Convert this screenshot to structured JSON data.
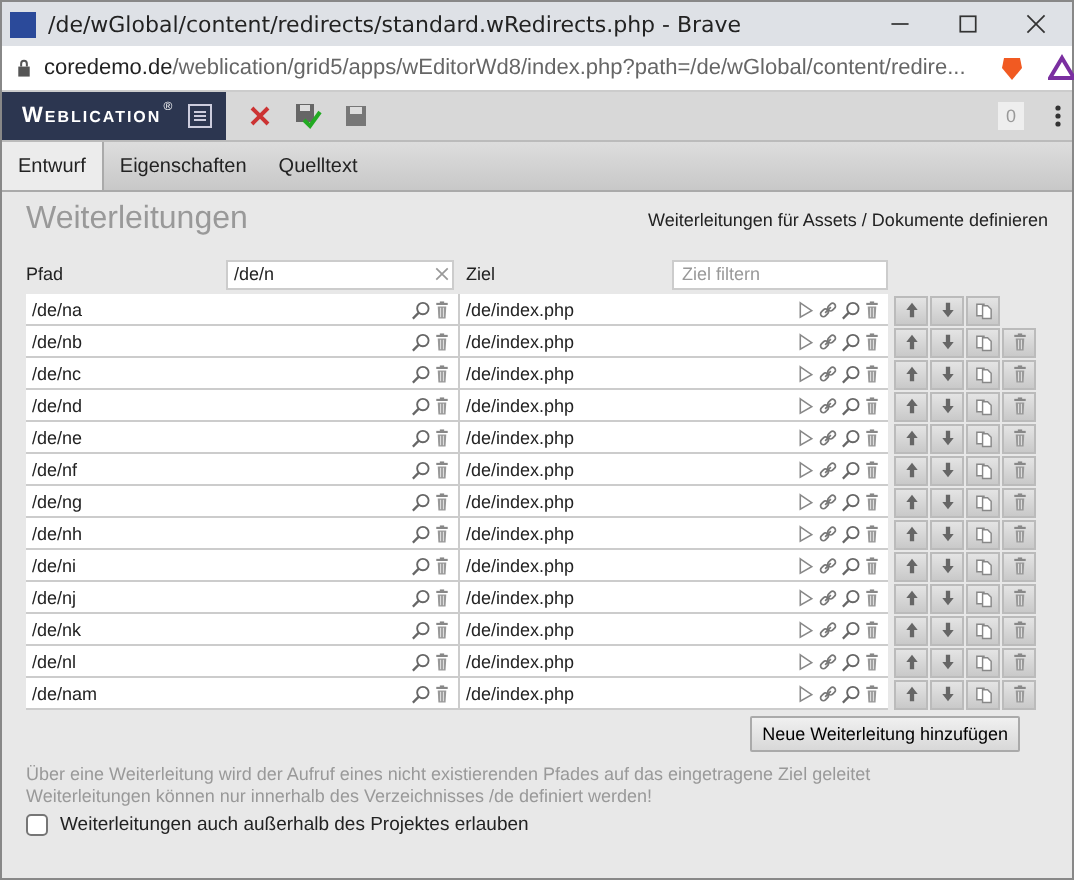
{
  "window": {
    "title": "/de/wGlobal/content/redirects/standard.wRedirects.php - Brave"
  },
  "address_bar": {
    "host": "coredemo.de",
    "path": "/weblication/grid5/apps/wEditorWd8/index.php?path=/de/wGlobal/content/redire..."
  },
  "app_bar": {
    "logo": "Weblication",
    "logo_mark": "®",
    "counter": "0"
  },
  "tabs": [
    {
      "label": "Entwurf",
      "selected": true
    },
    {
      "label": "Eigenschaften",
      "selected": false
    },
    {
      "label": "Quelltext",
      "selected": false
    }
  ],
  "page": {
    "title": "Weiterleitungen",
    "context_link": "Weiterleitungen für Assets / Dokumente definieren"
  },
  "columns": {
    "path_label": "Pfad",
    "path_filter": "/de/n",
    "target_label": "Ziel",
    "target_filter_placeholder": "Ziel filtern"
  },
  "rows": [
    {
      "path": "/de/na",
      "target": "/de/index.php",
      "deletable": false
    },
    {
      "path": "/de/nb",
      "target": "/de/index.php",
      "deletable": true
    },
    {
      "path": "/de/nc",
      "target": "/de/index.php",
      "deletable": true
    },
    {
      "path": "/de/nd",
      "target": "/de/index.php",
      "deletable": true
    },
    {
      "path": "/de/ne",
      "target": "/de/index.php",
      "deletable": true
    },
    {
      "path": "/de/nf",
      "target": "/de/index.php",
      "deletable": true
    },
    {
      "path": "/de/ng",
      "target": "/de/index.php",
      "deletable": true
    },
    {
      "path": "/de/nh",
      "target": "/de/index.php",
      "deletable": true
    },
    {
      "path": "/de/ni",
      "target": "/de/index.php",
      "deletable": true
    },
    {
      "path": "/de/nj",
      "target": "/de/index.php",
      "deletable": true
    },
    {
      "path": "/de/nk",
      "target": "/de/index.php",
      "deletable": true
    },
    {
      "path": "/de/nl",
      "target": "/de/index.php",
      "deletable": true
    },
    {
      "path": "/de/nam",
      "target": "/de/index.php",
      "deletable": true
    }
  ],
  "add_button": "Neue Weiterleitung hinzufügen",
  "notes": [
    "Über eine Weiterleitung wird der Aufruf eines nicht existierenden Pfades auf das eingetragene Ziel geleitet",
    "Weiterleitungen können nur innerhalb des Verzeichnisses /de definiert werden!"
  ],
  "option": {
    "label": "Weiterleitungen auch außerhalb des Projektes erlauben",
    "checked": false
  }
}
